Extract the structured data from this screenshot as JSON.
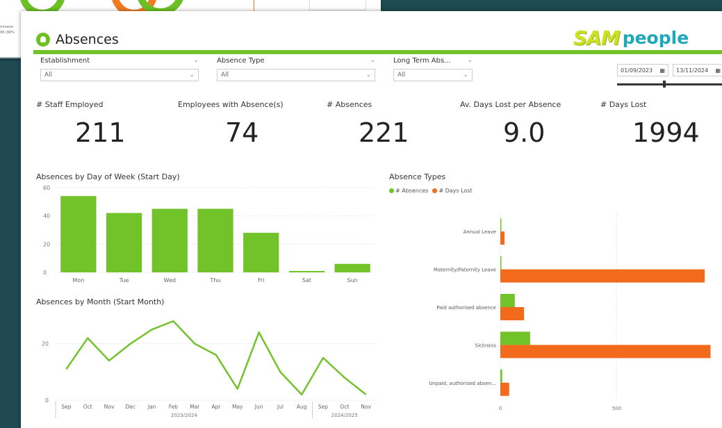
{
  "background_card": {
    "line1": "mmane",
    "line2": "06 (90%"
  },
  "page": {
    "title": "Absences",
    "brand_sam": "SAM",
    "brand_people": "people"
  },
  "filters": [
    {
      "label": "Establishment",
      "value": "All"
    },
    {
      "label": "Absence Type",
      "value": "All"
    },
    {
      "label": "Long Term Abs...",
      "value": "All"
    }
  ],
  "date_range": {
    "start": "01/09/2023",
    "end": "13/11/2024"
  },
  "kpis": [
    {
      "label": "# Staff Employed",
      "value": "211"
    },
    {
      "label": "Employees with Absence(s)",
      "value": "74"
    },
    {
      "label": "# Absences",
      "value": "221"
    },
    {
      "label": "Av. Days Lost per Absence",
      "value": "9.0"
    },
    {
      "label": "# Days Lost",
      "value": "1994"
    }
  ],
  "colors": {
    "green": "#72c22a",
    "orange": "#f26a1b",
    "brand_yellow": "#cde022",
    "brand_teal": "#1fa8b8"
  },
  "chart_data": [
    {
      "type": "bar",
      "title": "Absences by Day of Week (Start Day)",
      "categories": [
        "Mon",
        "Tue",
        "Wed",
        "Thu",
        "Fri",
        "Sat",
        "Sun"
      ],
      "values": [
        54,
        42,
        45,
        45,
        28,
        1,
        6
      ],
      "ylim": [
        0,
        60
      ],
      "yticks": [
        "0",
        "20",
        "40",
        "60"
      ]
    },
    {
      "type": "line",
      "title": "Absences by Month (Start Month)",
      "categories": [
        "Sep",
        "Oct",
        "Nov",
        "Dec",
        "Jan",
        "Feb",
        "Mar",
        "Apr",
        "May",
        "Jun",
        "Jul",
        "Aug",
        "Sep",
        "Oct",
        "Nov"
      ],
      "values": [
        11,
        22,
        14,
        20,
        25,
        28,
        20,
        16,
        4,
        24,
        10,
        2,
        15,
        8,
        2
      ],
      "ylim": [
        0,
        30
      ],
      "yticks": [
        "0",
        "20"
      ],
      "groups": [
        {
          "label": "2023/2024",
          "start": 0,
          "end": 11
        },
        {
          "label": "2024/2025",
          "start": 12,
          "end": 14
        }
      ]
    },
    {
      "type": "bar",
      "orientation": "horizontal",
      "title": "Absence Types",
      "categories": [
        "Annual Leave",
        "Maternity/Paternity Leave",
        "Paid authorised absence",
        "Sickness",
        "Unpaid, authorised absen..."
      ],
      "series": [
        {
          "name": "# Absences",
          "values": [
            4,
            4,
            62,
            128,
            8
          ]
        },
        {
          "name": "# Days Lost",
          "values": [
            18,
            878,
            102,
            903,
            38
          ]
        }
      ],
      "xlim": [
        0,
        1000
      ],
      "xticks": [
        "0",
        "500",
        "1000"
      ]
    }
  ]
}
